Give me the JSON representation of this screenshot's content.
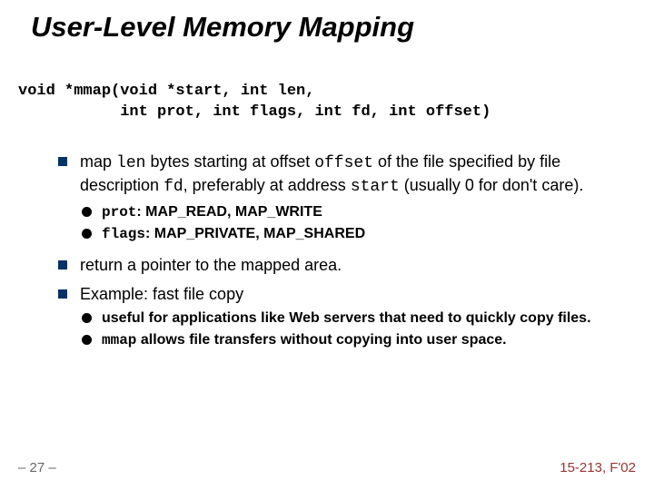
{
  "title": "User-Level Memory Mapping",
  "code": {
    "line1": "void *mmap(void *start, int len,",
    "line2": "           int prot, int flags, int fd, int offset)"
  },
  "bullets": {
    "b1": {
      "pre": "map ",
      "len": "len",
      "mid1": " bytes starting at offset ",
      "offset": "offset",
      "mid2": " of the file specified by file description ",
      "fd": "fd",
      "mid3": ", preferably at address ",
      "start": "start",
      "post": " (usually 0 for don't care)."
    },
    "sub1": {
      "s1a": "prot",
      "s1b": ": MAP_READ, MAP_WRITE",
      "s2a": "flags",
      "s2b": ": MAP_PRIVATE, MAP_SHARED"
    },
    "b2": "return a pointer to the mapped area.",
    "b3": "Example: fast file copy",
    "sub2": {
      "s1": "useful for applications like Web servers that need to quickly copy files.",
      "s2a": "mmap",
      "s2b": " allows file transfers without copying into user space."
    }
  },
  "footer": {
    "left": "– 27 –",
    "right": "15-213, F'02"
  }
}
